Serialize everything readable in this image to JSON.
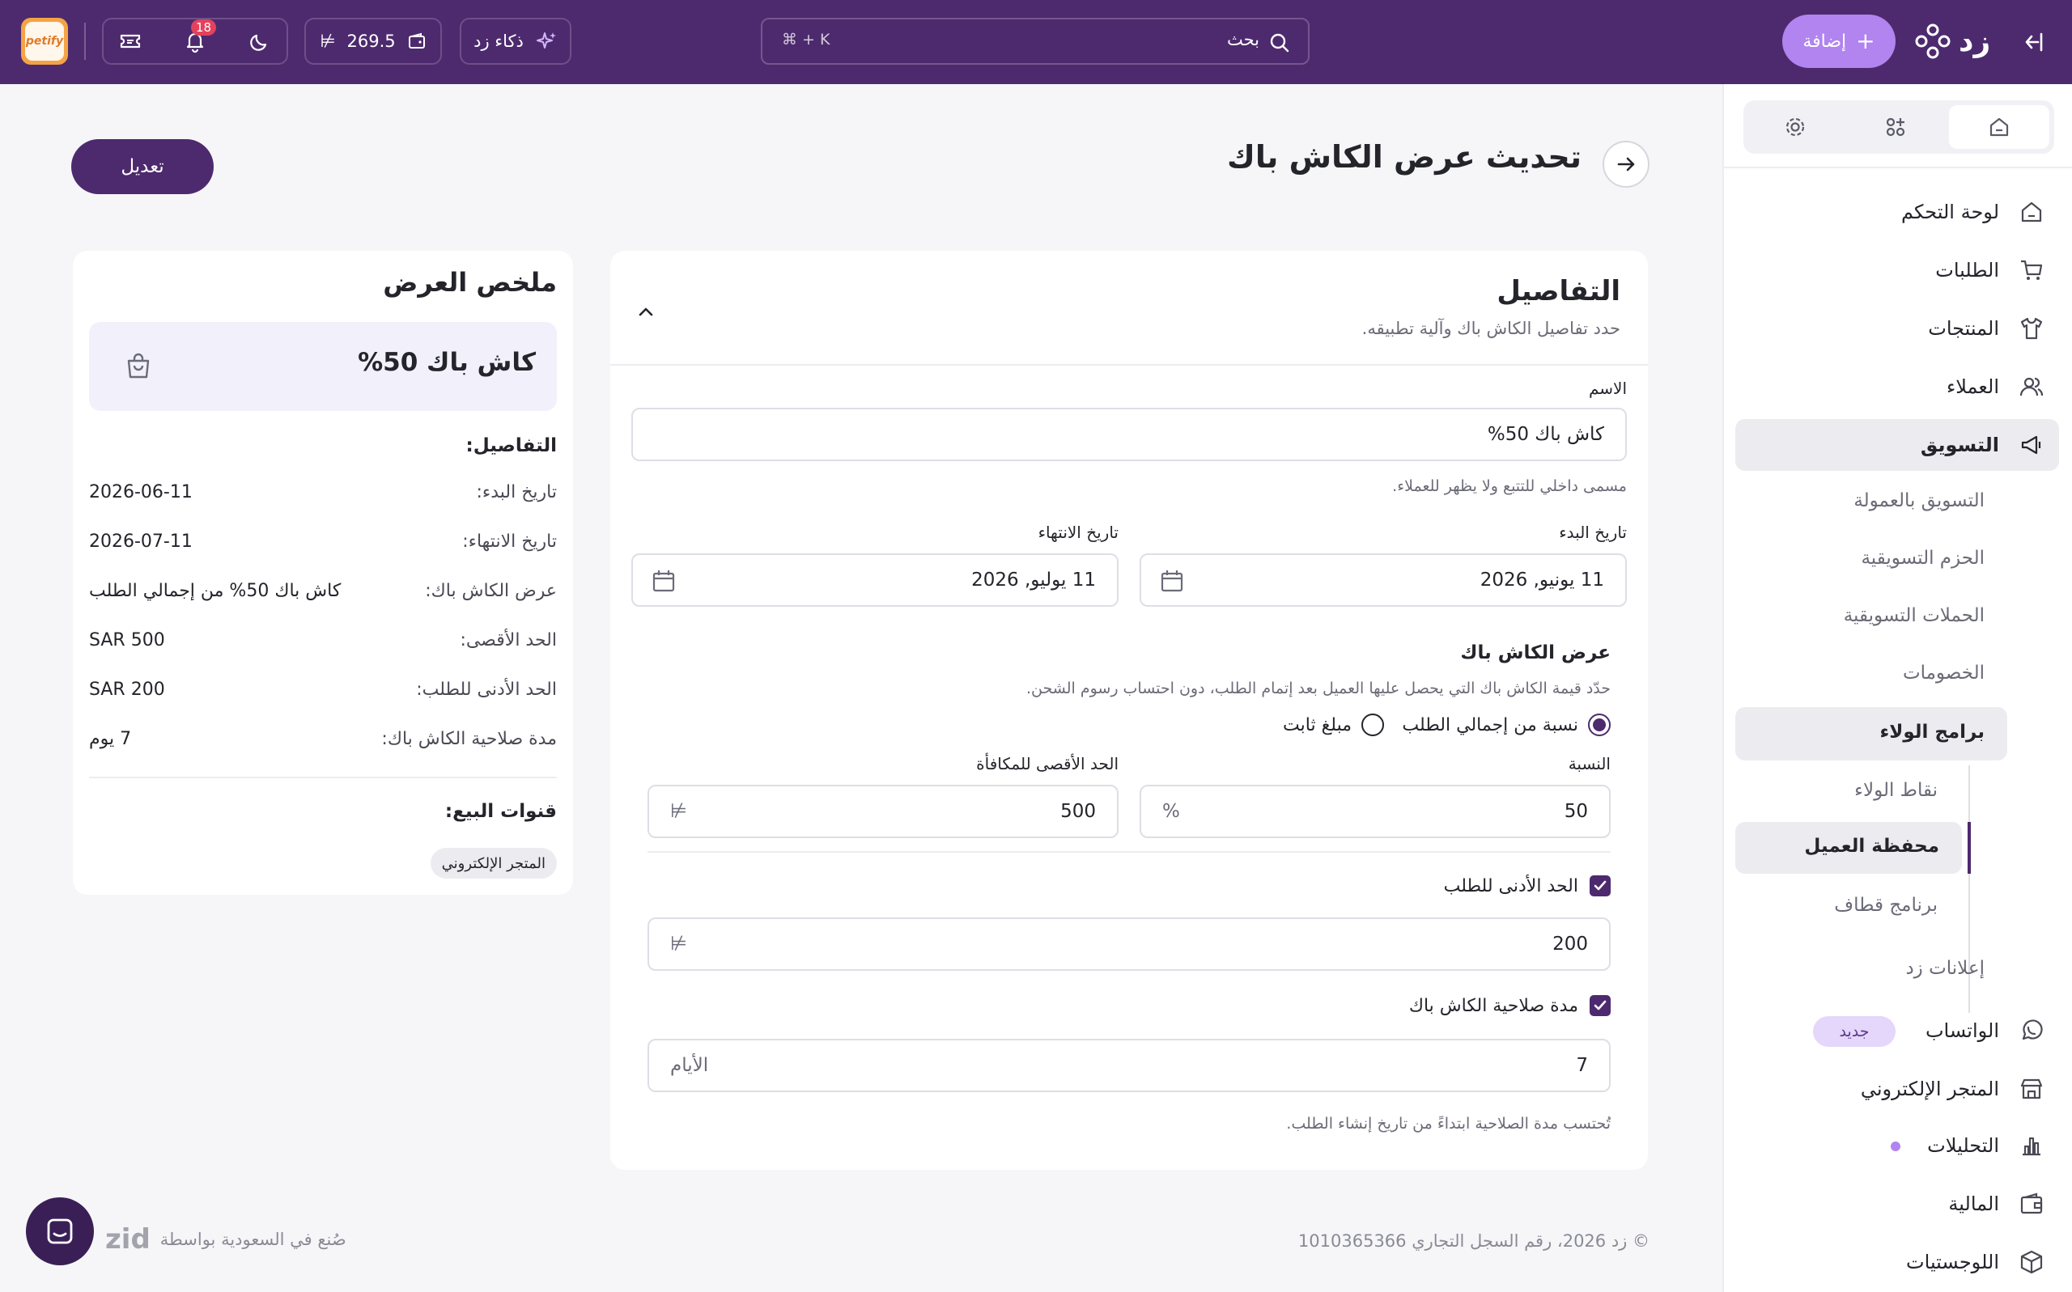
{
  "topbar": {
    "add_label": "إضافة",
    "logo_text": "زد",
    "search_placeholder": "بحث",
    "search_shortcut": "⌘ + K",
    "ai_label": "ذكاء زد",
    "wallet_amount": "269.5",
    "notifications_count": "18",
    "store_logo_text": "petify"
  },
  "sidebar": {
    "items": [
      {
        "label": "لوحة التحكم"
      },
      {
        "label": "الطلبات"
      },
      {
        "label": "المنتجات"
      },
      {
        "label": "العملاء"
      },
      {
        "label": "التسويق"
      },
      {
        "label": "التسويق بالعمولة"
      },
      {
        "label": "الحزم التسويقية"
      },
      {
        "label": "الحملات التسويقية"
      },
      {
        "label": "الخصومات"
      },
      {
        "label": "برامج الولاء"
      },
      {
        "label": "نقاط الولاء"
      },
      {
        "label": "محفظة العميل"
      },
      {
        "label": "برنامج قطاف"
      },
      {
        "label": "إعلانات زد"
      },
      {
        "label": "الواتساب"
      },
      {
        "label": "المتجر الإلكتروني"
      },
      {
        "label": "التحليلات"
      },
      {
        "label": "المالية"
      },
      {
        "label": "اللوجستيات"
      }
    ],
    "new_badge": "جديد"
  },
  "page": {
    "title": "تحديث عرض الكاش باك",
    "edit_button": "تعديل"
  },
  "details": {
    "title": "التفاصيل",
    "subtitle": "حدد تفاصيل الكاش باك وآلية تطبيقه.",
    "name_label": "الاسم",
    "name_value": "كاش باك 50%",
    "name_hint": "مسمى داخلي للتتبع ولا يظهر للعملاء.",
    "start_label": "تاريخ البدء",
    "start_value": "11 يونيو, 2026",
    "end_label": "تاريخ الانتهاء",
    "end_value": "11 يوليو, 2026",
    "offer_title": "عرض الكاش باك",
    "offer_desc": "حدّد قيمة الكاش باك التي يحصل عليها العميل بعد إتمام الطلب، دون احتساب رسوم الشحن.",
    "radio_percent": "نسبة من إجمالي الطلب",
    "radio_fixed": "مبلغ ثابت",
    "percent_label": "النسبة",
    "percent_value": "50",
    "percent_unit": "%",
    "max_label": "الحد الأقصى للمكافأة",
    "max_value": "500",
    "min_order_label": "الحد الأدنى للطلب",
    "min_order_value": "200",
    "validity_label": "مدة صلاحية الكاش باك",
    "validity_value": "7",
    "validity_unit": "الأيام",
    "validity_hint": "تُحتسب مدة الصلاحية ابتداءً من تاريخ إنشاء الطلب."
  },
  "summary": {
    "title": "ملخص العرض",
    "offer_name": "كاش باك 50%",
    "details_heading": "التفاصيل:",
    "rows": [
      {
        "k": "تاريخ البدء:",
        "v": "2026-06-11"
      },
      {
        "k": "تاريخ الانتهاء:",
        "v": "2026-07-11"
      },
      {
        "k": "عرض الكاش باك:",
        "v": "كاش باك 50% من إجمالي الطلب"
      },
      {
        "k": "الحد الأقصى:",
        "v": "SAR 500"
      },
      {
        "k": "الحد الأدنى للطلب:",
        "v": "SAR 200"
      },
      {
        "k": "مدة صلاحية الكاش باك:",
        "v": "7 يوم"
      }
    ],
    "channels_heading": "قنوات البيع:",
    "channel": "المتجر الإلكتروني"
  },
  "footer": {
    "copyright": "© زد 2026، رقم السجل التجاري 1010365366",
    "made_in": "صُنع في السعودية بواسطة",
    "brand": "zid"
  },
  "colors": {
    "brand": "#4d2a6e",
    "accent": "#b184f0",
    "badge_red": "#e3415d"
  }
}
